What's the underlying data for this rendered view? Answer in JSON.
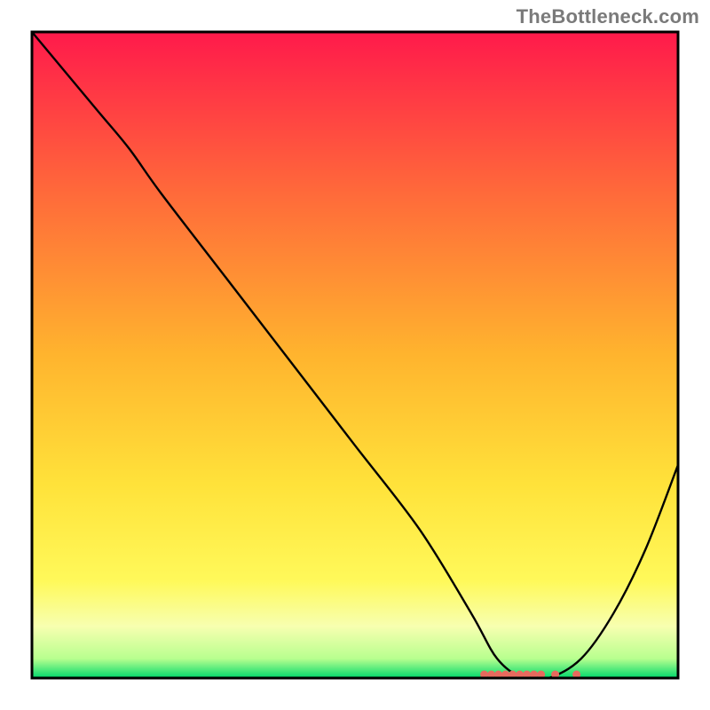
{
  "watermark": "TheBottleneck.com",
  "chart_data": {
    "type": "line",
    "title": "",
    "xlabel": "",
    "ylabel": "",
    "xlim": [
      0,
      100
    ],
    "ylim": [
      0,
      100
    ],
    "series": [
      {
        "name": "curve",
        "x": [
          0,
          10,
          15,
          20,
          30,
          40,
          50,
          60,
          68,
          72,
          76,
          80,
          85,
          90,
          95,
          100
        ],
        "y": [
          100,
          88,
          82,
          75,
          62,
          49,
          36,
          23,
          10,
          3,
          0,
          0,
          3,
          10,
          20,
          33
        ]
      }
    ],
    "minimum_band": {
      "x_start": 70,
      "x_end": 85
    },
    "gradient_stops": [
      {
        "offset": 0,
        "color": "#ff1a4b"
      },
      {
        "offset": 25,
        "color": "#ff6a3a"
      },
      {
        "offset": 50,
        "color": "#ffb42e"
      },
      {
        "offset": 70,
        "color": "#ffe23a"
      },
      {
        "offset": 85,
        "color": "#fff95a"
      },
      {
        "offset": 92,
        "color": "#f7ffb0"
      },
      {
        "offset": 97,
        "color": "#b8ff8f"
      },
      {
        "offset": 100,
        "color": "#00d96c"
      }
    ],
    "marker_color": "#e86a5e",
    "curve_color": "#000000",
    "frame_color": "#000000"
  }
}
